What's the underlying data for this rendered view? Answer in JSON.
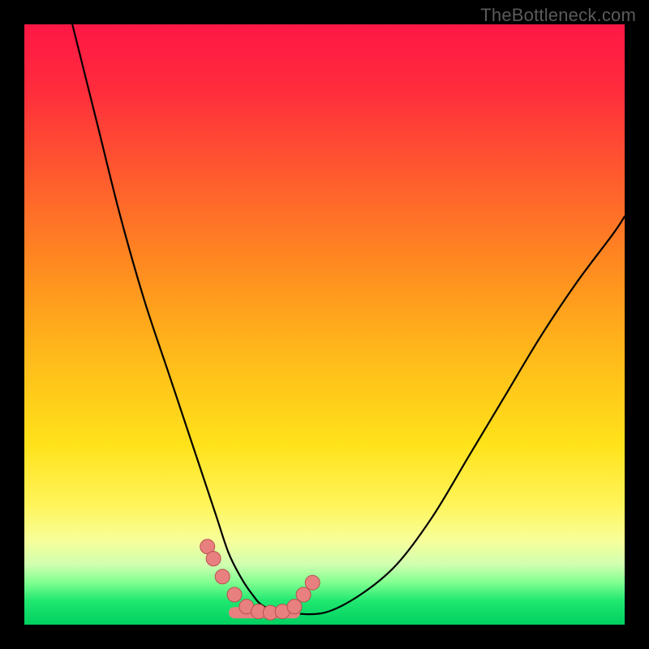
{
  "watermark": "TheBottleneck.com",
  "colors": {
    "frame_bg": "#000000",
    "gradient_top": "#ff1745",
    "gradient_mid": "#ffe21a",
    "gradient_bottom": "#00d060",
    "curve_stroke": "#000000",
    "marker_fill": "#e98080",
    "marker_stroke": "#b85050"
  },
  "chart_data": {
    "type": "line",
    "title": "",
    "xlabel": "",
    "ylabel": "",
    "xlim": [
      0,
      100
    ],
    "ylim": [
      0,
      100
    ],
    "series": [
      {
        "name": "bottleneck-curve",
        "x": [
          8,
          12,
          16,
          20,
          24,
          28,
          30,
          32,
          34,
          36,
          38,
          40,
          44,
          50,
          56,
          62,
          68,
          74,
          80,
          86,
          92,
          98,
          100
        ],
        "y": [
          100,
          84,
          68,
          54,
          42,
          30,
          24,
          18,
          12,
          8,
          5,
          3,
          2,
          2,
          5,
          10,
          18,
          28,
          38,
          48,
          57,
          65,
          68
        ]
      }
    ],
    "markers": {
      "name": "highlight-points",
      "x": [
        30.5,
        31.5,
        33.0,
        35.0,
        37.0,
        39.0,
        41.0,
        43.0,
        45.0,
        46.5,
        48.0
      ],
      "y": [
        13.0,
        11.0,
        8.0,
        5.0,
        3.0,
        2.2,
        2.0,
        2.2,
        3.0,
        5.0,
        7.0
      ]
    },
    "trough_band": {
      "x": [
        35,
        45
      ],
      "y": 2
    },
    "grid": false,
    "legend": null
  }
}
